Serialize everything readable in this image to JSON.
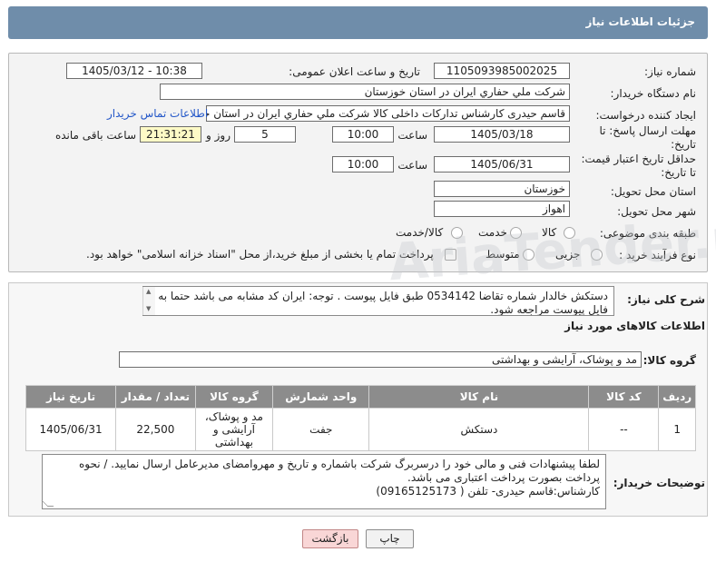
{
  "header": {
    "title": "جزئیات اطلاعات نیاز"
  },
  "form": {
    "need_number_label": "شماره نیاز:",
    "need_number": "1105093985002025",
    "announce_label": "تاریخ و ساعت اعلان عمومی:",
    "announce_value": "1405/03/12 - 10:38",
    "buyer_org_label": "نام دستگاه خریدار:",
    "buyer_org": "شرکت ملي حفاري ايران در استان خوزستان",
    "requester_label": "ایجاد کننده درخواست:",
    "requester": "قاسم حیدری کارشناس تدارکات داخلی کالا شرکت ملي حفاري ايران در استان خوزستان",
    "contact_link": "اطلاعات تماس خریدار",
    "deadline_label_1": "مهلت ارسال پاسخ: تا",
    "deadline_label_2": "تاریخ:",
    "deadline_date": "1405/03/18",
    "time_label": "ساعت",
    "deadline_time": "10:00",
    "days_value": "5",
    "days_label": "روز و",
    "remaining_value": "21:31:21",
    "remaining_label": "ساعت باقی مانده",
    "validity_label_1": "حداقل تاریخ اعتبار قیمت:",
    "validity_label_2": "تا تاریخ:",
    "validity_date": "1405/06/31",
    "validity_time": "10:00",
    "province_label": "استان محل تحویل:",
    "province": "خوزستان",
    "city_label": "شهر محل تحویل:",
    "city": "اهواز",
    "category_label": "طبقه بندی موضوعی:",
    "category_options": [
      "کالا",
      "خدمت",
      "کالا/خدمت"
    ],
    "purchase_type_label": "نوع فرآیند خرید :",
    "purchase_options": [
      "جزیی",
      "متوسط"
    ],
    "treasury_note": "پرداخت تمام یا بخشی از مبلغ خرید،از محل \"اسناد خزانه اسلامی\" خواهد بود."
  },
  "summary": {
    "label": "شرح کلی نیاز:",
    "text": "دستکش خالدار شماره تقاضا 0534142 طبق فایل پیوست . توجه: ایران کد مشابه می باشد حتما به فایل پیوست مراجعه شود."
  },
  "goods": {
    "section_title": "اطلاعات کالاهای مورد نیاز",
    "group_label": "گروه کالا:",
    "group_value": "مد و پوشاک، آرایشی و بهداشتی",
    "columns": [
      "ردیف",
      "کد کالا",
      "نام کالا",
      "واحد شمارش",
      "گروه کالا",
      "تعداد / مقدار",
      "تاریخ نیاز"
    ],
    "rows": [
      {
        "row": "1",
        "code": "--",
        "name": "دستکش",
        "unit": "جفت",
        "group": "مد و پوشاک، آرایشی و بهداشتی",
        "qty": "22,500",
        "date": "1405/06/31"
      }
    ]
  },
  "notes": {
    "label": "توضیحات خریدار:",
    "line1": "لطفا پیشنهادات فنی و مالی خود را درسربرگ شرکت باشماره و تاریخ و مهروامضای مدیرعامل ارسال نمایید. / نحوه پرداخت بصورت پرداخت اعتباری می باشد.",
    "line2": "کارشناس:قاسم حیدری- تلفن ( 09165125173)"
  },
  "buttons": {
    "print": "چاپ",
    "back": "بازگشت"
  }
}
